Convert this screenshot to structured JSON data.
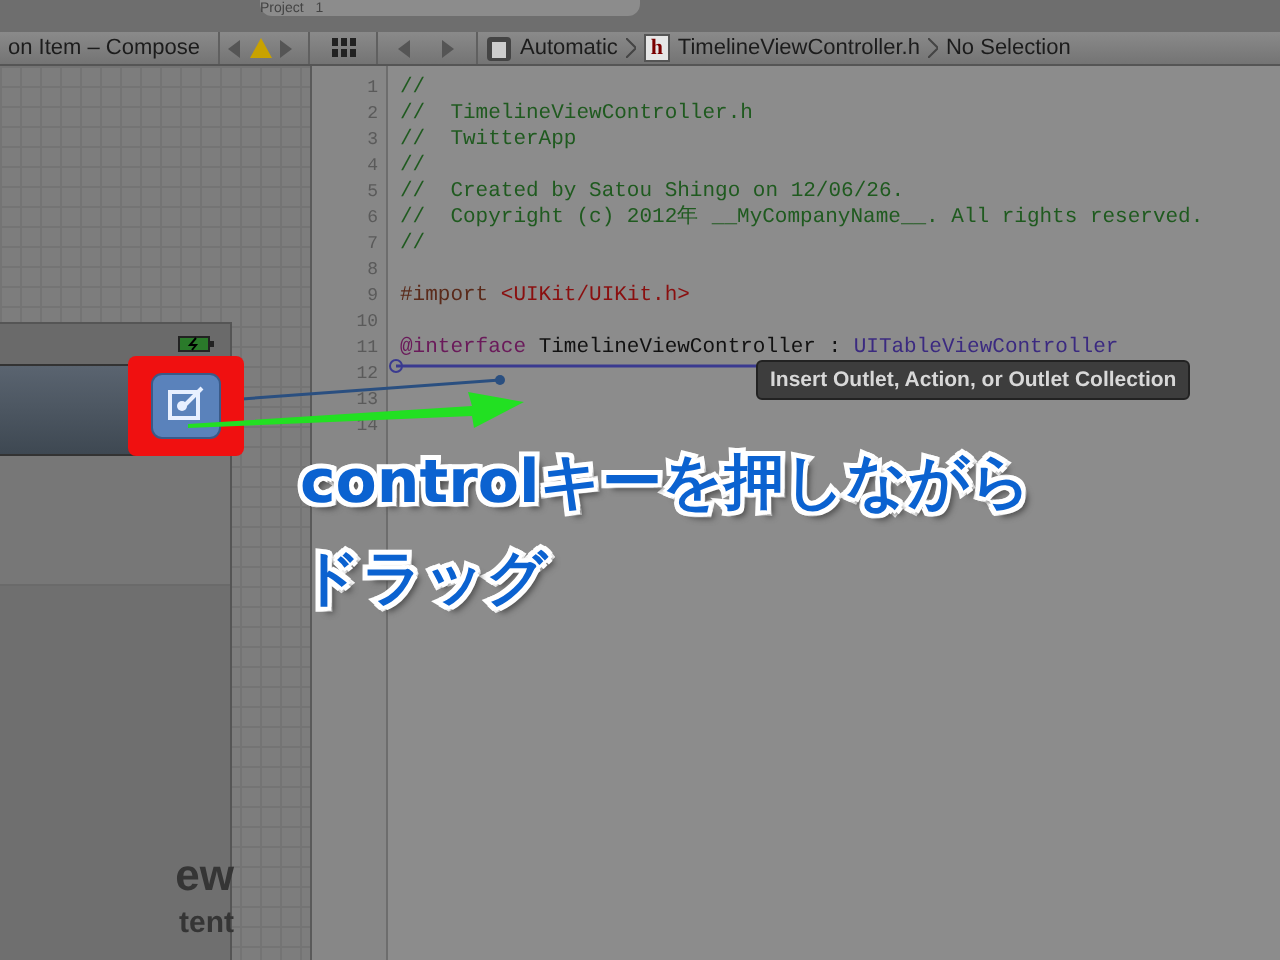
{
  "top_strip": {
    "label": "Project",
    "count": "1"
  },
  "toolbar": {
    "left_title": "on Item – Compose",
    "path": [
      {
        "kind": "scheme",
        "text": "Automatic"
      },
      {
        "kind": "file",
        "badge": "h",
        "text": "TimelineViewController.h"
      },
      {
        "kind": "plain",
        "text": "No Selection"
      }
    ]
  },
  "canvas": {
    "labels": [
      "ew",
      "tent"
    ]
  },
  "editor": {
    "lines": [
      {
        "number": "1",
        "kind": "comment",
        "text": "//"
      },
      {
        "number": "2",
        "kind": "comment",
        "text": "//  TimelineViewController.h"
      },
      {
        "number": "3",
        "kind": "comment",
        "text": "//  TwitterApp"
      },
      {
        "number": "4",
        "kind": "comment",
        "text": "//"
      },
      {
        "number": "5",
        "kind": "comment",
        "text": "//  Created by Satou Shingo on 12/06/26."
      },
      {
        "number": "6",
        "kind": "comment",
        "text": "//  Copyright (c) 2012年 __MyCompanyName__. All rights reserved."
      },
      {
        "number": "7",
        "kind": "comment",
        "text": "//"
      },
      {
        "number": "8",
        "kind": "blank"
      },
      {
        "number": "9",
        "kind": "import",
        "keyword": "#import",
        "text": "<UIKit/UIKit.h>"
      },
      {
        "number": "10",
        "kind": "blank"
      },
      {
        "number": "11",
        "kind": "interface",
        "keyword": "@interface",
        "text": "TimelineViewController :",
        "type": "UITableViewController"
      },
      {
        "number": "12",
        "kind": "blank"
      },
      {
        "number": "13",
        "kind": "blank"
      },
      {
        "number": "14",
        "kind": "blank"
      }
    ]
  },
  "tooltip": "Insert Outlet, Action, or Outlet Collection",
  "callout": [
    "controlキーを押しながら",
    "ドラッグ"
  ]
}
